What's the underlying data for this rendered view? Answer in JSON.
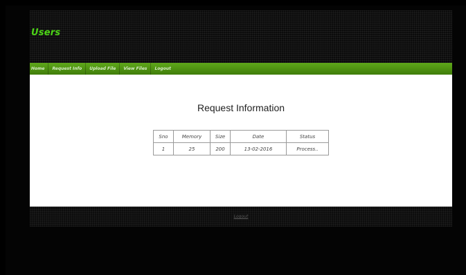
{
  "header": {
    "title": "Users"
  },
  "nav": {
    "items": [
      {
        "label": "Home"
      },
      {
        "label": "Request Info"
      },
      {
        "label": "Upload File"
      },
      {
        "label": "View Files"
      },
      {
        "label": "Logout"
      }
    ]
  },
  "main": {
    "title": "Request Information",
    "table": {
      "columns": [
        "Sno",
        "Memory",
        "Size",
        "Date",
        "Status"
      ],
      "rows": [
        [
          "1",
          "25",
          "200",
          "13-02-2016",
          "Process.."
        ]
      ]
    }
  },
  "footer": {
    "link": "Logout"
  },
  "colors": {
    "accent": "#4cd316",
    "nav": "#4f9412"
  }
}
